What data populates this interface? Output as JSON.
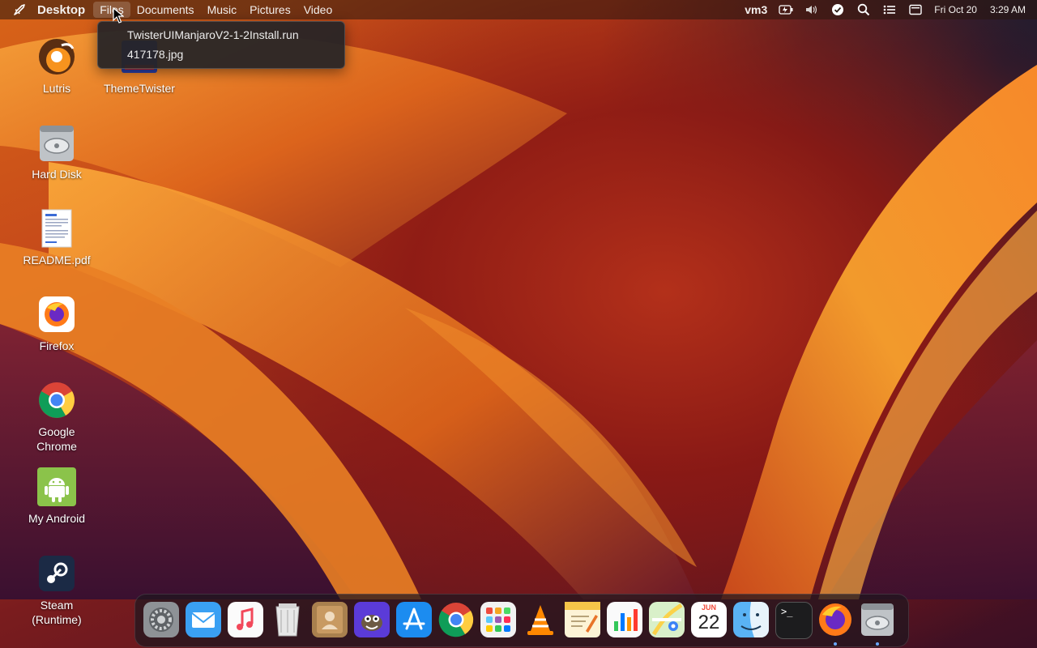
{
  "menubar": {
    "app_name": "Desktop",
    "menus": [
      "Files",
      "Documents",
      "Music",
      "Pictures",
      "Video"
    ],
    "active_menu": "Files",
    "user": "vm3",
    "date": "Fri Oct 20",
    "time": "3:29 AM"
  },
  "dropdown": {
    "items": [
      "TwisterUIManjaroV2-1-2Install.run",
      "417178.jpg"
    ]
  },
  "desktop_icons": [
    {
      "label": "Lutris",
      "icon": "lutris-icon"
    },
    {
      "label": "ThemeTwister",
      "icon": "themetwister-icon"
    },
    {
      "label": "Hard Disk",
      "icon": "hard-disk-icon"
    },
    {
      "label": "README.pdf",
      "icon": "pdf-document-icon"
    },
    {
      "label": "Firefox",
      "icon": "firefox-icon"
    },
    {
      "label": "Google Chrome",
      "icon": "chrome-icon"
    },
    {
      "label": "My Android",
      "icon": "android-icon"
    },
    {
      "label": "Steam (Runtime)",
      "icon": "steam-icon"
    }
  ],
  "dock": {
    "items": [
      {
        "name": "system-settings-icon"
      },
      {
        "name": "mail-icon"
      },
      {
        "name": "music-icon"
      },
      {
        "name": "trash-icon"
      },
      {
        "name": "contacts-icon"
      },
      {
        "name": "gimp-icon"
      },
      {
        "name": "app-store-icon"
      },
      {
        "name": "chrome-icon"
      },
      {
        "name": "launchpad-icon"
      },
      {
        "name": "vlc-icon"
      },
      {
        "name": "text-editor-icon"
      },
      {
        "name": "numbers-chart-icon"
      },
      {
        "name": "maps-icon"
      },
      {
        "name": "calendar-icon",
        "month": "JUN",
        "day": "22"
      },
      {
        "name": "finder-icon"
      },
      {
        "name": "terminal-icon",
        "text": ">_"
      },
      {
        "name": "firefox-icon"
      },
      {
        "name": "hard-disk-icon"
      }
    ]
  },
  "colors": {
    "menubar_text": "#f3f0ee",
    "dock_indicator": "#6aa8ff"
  }
}
